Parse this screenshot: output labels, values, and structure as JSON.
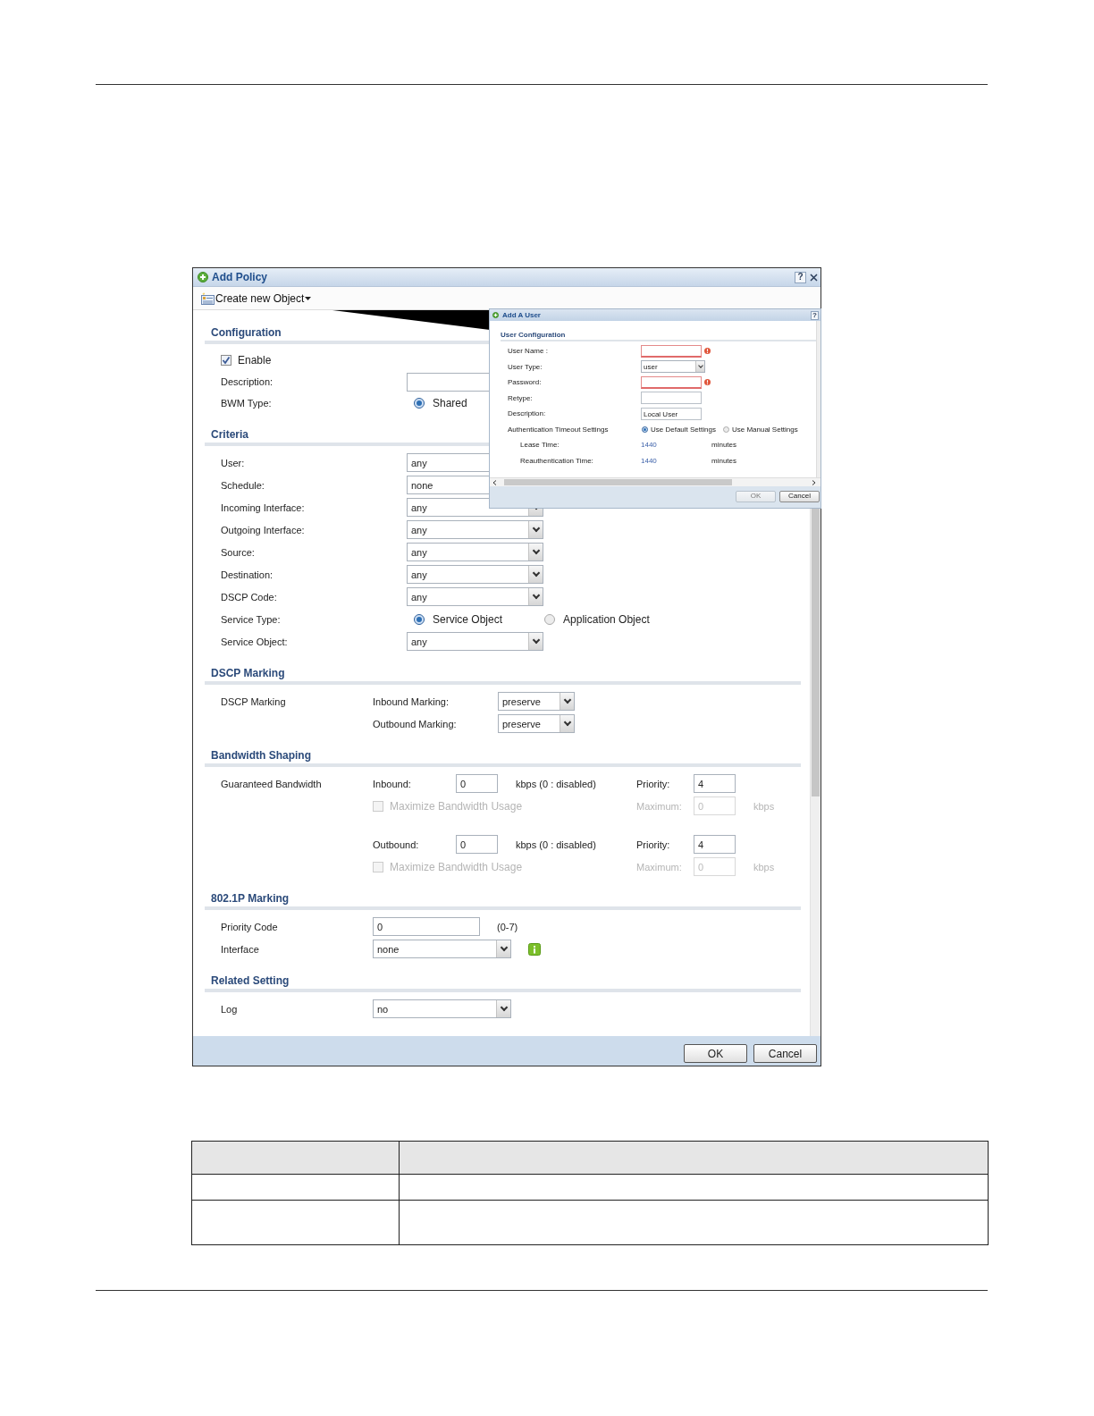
{
  "dialog": {
    "title": "Add Policy",
    "help": "?",
    "toolbar": {
      "label": "Create new Object"
    },
    "sections": [
      {
        "heading": "Configuration",
        "kind": "form",
        "rows": [
          {
            "kind": "plain",
            "controls": [
              {
                "kind": "checkbox",
                "label": "Enable",
                "checked": true
              }
            ]
          },
          {
            "label": "Description:",
            "controls": [
              {
                "kind": "text"
              }
            ]
          },
          {
            "label": "BWM Type:",
            "controls": [
              {
                "kind": "radio",
                "label": "Shared",
                "selected": true
              }
            ]
          }
        ]
      },
      {
        "heading": "Criteria",
        "kind": "form",
        "rows": [
          {
            "label": "User:",
            "controls": [
              {
                "kind": "select",
                "value": "any"
              }
            ]
          },
          {
            "label": "Schedule:",
            "controls": [
              {
                "kind": "select",
                "value": "none"
              }
            ]
          },
          {
            "label": "Incoming Interface:",
            "controls": [
              {
                "kind": "select",
                "value": "any"
              }
            ]
          },
          {
            "label": "Outgoing Interface:",
            "controls": [
              {
                "kind": "select",
                "value": "any"
              }
            ]
          },
          {
            "label": "Source:",
            "controls": [
              {
                "kind": "select",
                "value": "any"
              }
            ]
          },
          {
            "label": "Destination:",
            "controls": [
              {
                "kind": "select",
                "value": "any"
              }
            ]
          },
          {
            "label": "DSCP Code:",
            "controls": [
              {
                "kind": "select",
                "value": "any"
              }
            ]
          },
          {
            "label": "Service Type:",
            "controls": [
              {
                "kind": "radio",
                "label": "Service Object",
                "selected": true
              },
              {
                "kind": "radio",
                "label": "Application Object",
                "selected": false
              }
            ]
          },
          {
            "label": "Service Object:",
            "controls": [
              {
                "kind": "select",
                "value": "any"
              }
            ]
          }
        ]
      },
      {
        "heading": "DSCP Marking",
        "kind": "marking",
        "rows": [
          {
            "label": "DSCP Marking",
            "controls": [
              {
                "kind": "label",
                "text": "Inbound Marking:"
              },
              {
                "kind": "select",
                "value": "preserve"
              }
            ]
          },
          {
            "controls": [
              {
                "kind": "label",
                "text": "Outbound Marking:"
              },
              {
                "kind": "select",
                "value": "preserve"
              }
            ]
          }
        ]
      },
      {
        "heading": "Bandwidth Shaping",
        "kind": "bandwidth",
        "rows": [
          {
            "label": "Guaranteed Bandwidth",
            "kind": "main",
            "controls": [
              {
                "kind": "label",
                "text": "Inbound:",
                "disabled": false
              },
              {
                "kind": "text",
                "value": "0",
                "disabled": false
              },
              {
                "kind": "note",
                "text": "kbps (0 : disabled)",
                "disabled": false
              },
              {
                "kind": "label",
                "text": "Priority:",
                "disabled": false
              },
              {
                "kind": "text",
                "value": "4",
                "disabled": false
              }
            ]
          },
          {
            "kind": "sub",
            "controls": [
              {
                "kind": "checkbox",
                "label": "Maximize Bandwidth Usage",
                "checked": false,
                "disabled": true
              },
              {
                "kind": "label",
                "text": "Maximum:",
                "disabled": true
              },
              {
                "kind": "text",
                "value": "0",
                "disabled": true
              },
              {
                "kind": "note",
                "text": "kbps",
                "disabled": true
              }
            ]
          },
          {
            "kind": "main",
            "controls": [
              {
                "kind": "label",
                "text": "Outbound:",
                "disabled": false
              },
              {
                "kind": "text",
                "value": "0",
                "disabled": false
              },
              {
                "kind": "note",
                "text": "kbps (0 : disabled)",
                "disabled": false
              },
              {
                "kind": "label",
                "text": "Priority:",
                "disabled": false
              },
              {
                "kind": "text",
                "value": "4",
                "disabled": false
              }
            ]
          },
          {
            "kind": "sub",
            "controls": [
              {
                "kind": "checkbox",
                "label": "Maximize Bandwidth Usage",
                "checked": false,
                "disabled": true
              },
              {
                "kind": "label",
                "text": "Maximum:",
                "disabled": true
              },
              {
                "kind": "text",
                "value": "0",
                "disabled": true
              },
              {
                "kind": "note",
                "text": "kbps",
                "disabled": true
              }
            ]
          }
        ]
      },
      {
        "heading": "802.1P Marking",
        "kind": "wide",
        "rows": [
          {
            "label": "Priority Code",
            "controls": [
              {
                "kind": "text",
                "value": "0"
              },
              {
                "kind": "note",
                "text": "(0-7)"
              }
            ]
          },
          {
            "label": "Interface",
            "controls": [
              {
                "kind": "select",
                "value": "none"
              },
              {
                "kind": "info"
              }
            ]
          }
        ]
      },
      {
        "heading": "Related Setting",
        "kind": "wide",
        "rows": [
          {
            "label": "Log",
            "controls": [
              {
                "kind": "select",
                "value": "no"
              }
            ]
          }
        ]
      }
    ],
    "buttons": [
      {
        "label": "OK"
      },
      {
        "label": "Cancel"
      }
    ]
  },
  "popup": {
    "title": "Add A User",
    "help": "?",
    "heading": "User Configuration",
    "rows": [
      {
        "label": "User Name :",
        "controls": [
          {
            "kind": "text",
            "error": true
          }
        ]
      },
      {
        "label": "User Type:",
        "controls": [
          {
            "kind": "select",
            "value": "user"
          }
        ]
      },
      {
        "label": "Password:",
        "controls": [
          {
            "kind": "text",
            "error": true
          }
        ]
      },
      {
        "label": "Retype:",
        "controls": [
          {
            "kind": "text",
            "error": false
          }
        ]
      },
      {
        "label": "Description:",
        "controls": [
          {
            "kind": "text",
            "value": "Local User",
            "error": false
          }
        ]
      },
      {
        "label": "Authentication Timeout Settings",
        "controls": [
          {
            "kind": "radio",
            "label": "Use Default Settings",
            "selected": true
          },
          {
            "kind": "radio",
            "label": "Use Manual Settings",
            "selected": false
          }
        ]
      },
      {
        "label": "Lease Time:",
        "kind": "indent",
        "controls": [
          {
            "kind": "value",
            "text": "1440"
          },
          {
            "kind": "note",
            "text": "minutes"
          }
        ]
      },
      {
        "label": "Reauthentication Time:",
        "kind": "indent",
        "controls": [
          {
            "kind": "value",
            "text": "1440"
          },
          {
            "kind": "note",
            "text": "minutes"
          }
        ]
      }
    ],
    "buttons": [
      {
        "label": "OK",
        "disabled": true
      },
      {
        "label": "Cancel",
        "disabled": false
      }
    ]
  }
}
